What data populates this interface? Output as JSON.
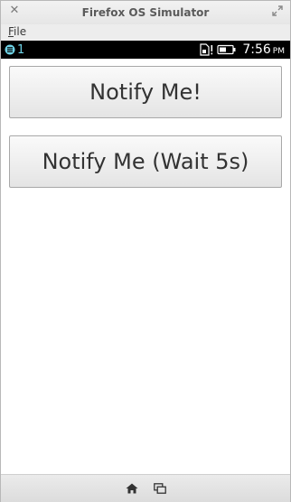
{
  "window": {
    "title": "Firefox OS Simulator"
  },
  "menu": {
    "file_prefix": "F",
    "file_rest": "ile"
  },
  "status": {
    "notification_count": "1",
    "time": "7:56",
    "ampm": "PM"
  },
  "buttons": {
    "notify": "Notify Me!",
    "notify_wait": "Notify Me (Wait 5s)"
  },
  "icons": {
    "close": "close-icon",
    "maximize": "maximize-icon",
    "notification": "notification-icon",
    "sim": "sim-icon",
    "battery": "battery-icon",
    "home": "home-icon",
    "cards": "cards-view-icon"
  },
  "colors": {
    "status_bar_bg": "#000000",
    "notification_accent": "#6fd3e6",
    "button_text": "#333333"
  }
}
